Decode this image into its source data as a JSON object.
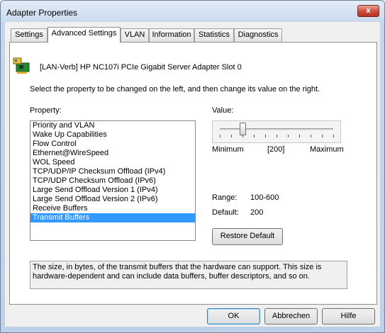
{
  "window": {
    "title": "Adapter Properties",
    "close_glyph": "x"
  },
  "tabs": [
    {
      "label": "Settings"
    },
    {
      "label": "Advanced Settings",
      "active": true
    },
    {
      "label": "VLAN"
    },
    {
      "label": "Information"
    },
    {
      "label": "Statistics"
    },
    {
      "label": "Diagnostics"
    }
  ],
  "adapter": {
    "icon": "network-adapter-icon",
    "name": "[LAN-Verb] HP NC107i PCIe Gigabit Server Adapter Slot 0"
  },
  "instructions": "Select the property to be changed on the left, and then change its value on the right.",
  "property": {
    "label": "Property:",
    "items": [
      "Priority and VLAN",
      "Wake Up Capabilities",
      "Flow Control",
      "Ethernet@WireSpeed",
      "WOL Speed",
      "TCP/UDP/IP Checksum Offload (IPv4)",
      "TCP/UDP Checksum Offload (IPv6)",
      "Large Send Offload Version 1 (IPv4)",
      "Large Send Offload Version 2 (IPv6)",
      "Receive Buffers",
      "Transmit Buffers"
    ],
    "selected": "Transmit Buffers"
  },
  "value": {
    "label": "Value:",
    "min_label": "Minimum",
    "max_label": "Maximum",
    "current_display": "[200]",
    "min": 100,
    "max": 600,
    "current": 200
  },
  "range": {
    "label": "Range:",
    "value": "100-600"
  },
  "default": {
    "label": "Default:",
    "value": "200"
  },
  "restore_button": "Restore Default",
  "description": "The size, in bytes, of the transmit buffers that the hardware can support. This size is hardware-dependent and can include data buffers, buffer descriptors, and so on.",
  "footer": {
    "ok": "OK",
    "cancel": "Abbrechen",
    "help": "Hilfe"
  },
  "colors": {
    "selection": "#3399ff",
    "close_button": "#c84c3a"
  }
}
